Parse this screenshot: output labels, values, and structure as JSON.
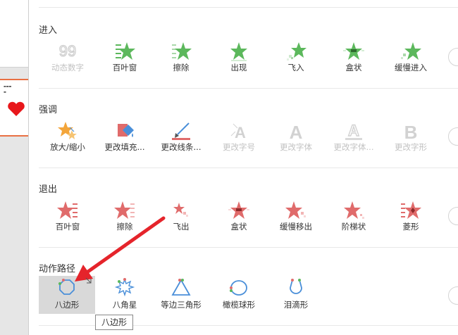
{
  "sections": [
    {
      "title": "进入",
      "items": [
        {
          "label": "动态数字",
          "icon": "number-99-icon",
          "disabled": true
        },
        {
          "label": "百叶窗",
          "icon": "blinds-star-icon",
          "disabled": false
        },
        {
          "label": "擦除",
          "icon": "wipe-star-icon",
          "disabled": false
        },
        {
          "label": "出现",
          "icon": "appear-star-icon",
          "disabled": false
        },
        {
          "label": "飞入",
          "icon": "fly-in-star-icon",
          "disabled": false
        },
        {
          "label": "盒状",
          "icon": "box-star-icon",
          "disabled": false
        },
        {
          "label": "缓慢进入",
          "icon": "crawl-in-star-icon",
          "disabled": false
        }
      ]
    },
    {
      "title": "强调",
      "items": [
        {
          "label": "放大/缩小",
          "icon": "grow-shrink-icon",
          "disabled": false
        },
        {
          "label": "更改填充...",
          "icon": "change-fill-icon",
          "disabled": false
        },
        {
          "label": "更改线条...",
          "icon": "change-line-icon",
          "disabled": false
        },
        {
          "label": "更改字号",
          "icon": "change-font-size-icon",
          "disabled": true
        },
        {
          "label": "更改字体",
          "icon": "change-font-icon",
          "disabled": true
        },
        {
          "label": "更改字体...",
          "icon": "change-font-color-icon",
          "disabled": true
        },
        {
          "label": "更改字形",
          "icon": "change-font-style-icon",
          "disabled": true
        }
      ]
    },
    {
      "title": "退出",
      "items": [
        {
          "label": "百叶窗",
          "icon": "blinds-exit-icon",
          "disabled": false
        },
        {
          "label": "擦除",
          "icon": "wipe-exit-icon",
          "disabled": false
        },
        {
          "label": "飞出",
          "icon": "fly-out-icon",
          "disabled": false
        },
        {
          "label": "盒状",
          "icon": "box-exit-icon",
          "disabled": false
        },
        {
          "label": "缓慢移出",
          "icon": "crawl-out-icon",
          "disabled": false
        },
        {
          "label": "阶梯状",
          "icon": "step-exit-icon",
          "disabled": false
        },
        {
          "label": "菱形",
          "icon": "diamond-exit-icon",
          "disabled": false
        }
      ]
    },
    {
      "title": "动作路径",
      "items": [
        {
          "label": "八边形",
          "icon": "octagon-path-icon",
          "disabled": false,
          "selected": true
        },
        {
          "label": "八角星",
          "icon": "eight-point-star-path-icon",
          "disabled": false
        },
        {
          "label": "等边三角形",
          "icon": "triangle-path-icon",
          "disabled": false
        },
        {
          "label": "橄榄球形",
          "icon": "football-path-icon",
          "disabled": false
        },
        {
          "label": "泪滴形",
          "icon": "teardrop-path-icon",
          "disabled": false
        }
      ]
    }
  ],
  "tooltip": "八边形",
  "colors": {
    "enter": "#5cb85c",
    "exit": "#e06b6b",
    "emphasis_orange": "#f3a53a",
    "path_blue": "#4a8fd9",
    "disabled": "#c8c8c8",
    "annotation": "#e5242b"
  }
}
